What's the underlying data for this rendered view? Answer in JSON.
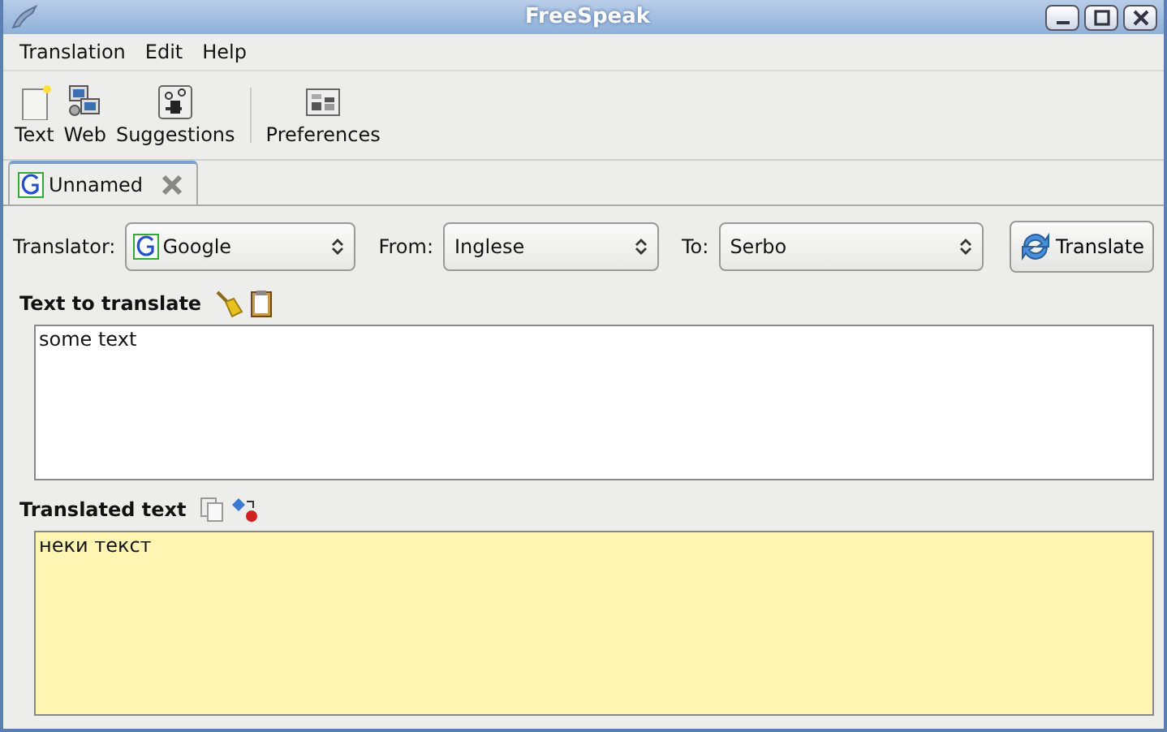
{
  "window": {
    "title": "FreeSpeak"
  },
  "menu": [
    "Translation",
    "Edit",
    "Help"
  ],
  "toolbar": [
    {
      "label": "Text",
      "kind": "text"
    },
    {
      "label": "Web",
      "kind": "web"
    },
    {
      "label": "Suggestions",
      "kind": "suggestions"
    },
    {
      "label": "Preferences",
      "kind": "preferences"
    }
  ],
  "tabs": [
    {
      "label": "Unnamed",
      "selected": true
    }
  ],
  "translator": {
    "label": "Translator:",
    "value": "Google"
  },
  "from": {
    "label": "From:",
    "value": "Inglese"
  },
  "to": {
    "label": "To:",
    "value": "Serbo"
  },
  "translate_button": "Translate",
  "source": {
    "heading": "Text to translate",
    "value": "some text"
  },
  "result": {
    "heading": "Translated text",
    "value": "неки текст"
  }
}
